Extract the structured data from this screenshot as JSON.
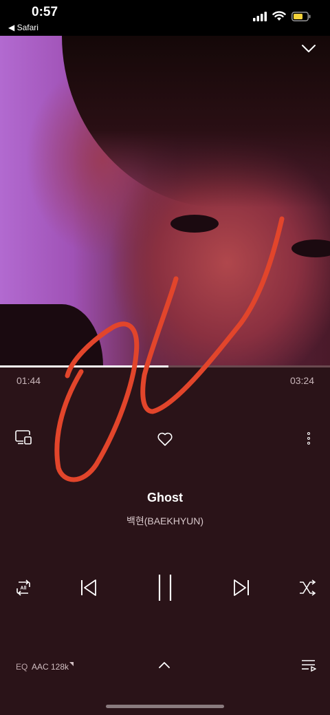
{
  "status_bar": {
    "time": "0:57",
    "back_app": "◀ Safari"
  },
  "player": {
    "progress": {
      "elapsed": "01:44",
      "total": "03:24",
      "fraction": 0.51
    },
    "track": {
      "title": "Ghost",
      "artist": "백현(BAEKHYUN)"
    },
    "bottom_bar": {
      "eq_label": "EQ",
      "quality_label": "AAC 128k"
    }
  },
  "colors": {
    "background": "#2a1318",
    "scribble": "#e2452b",
    "battery": "#f5d33a"
  }
}
